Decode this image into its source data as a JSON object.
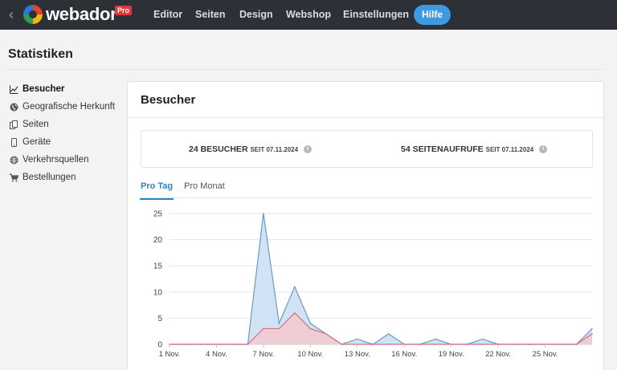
{
  "topbar": {
    "brand": "webador",
    "badge": "Pro",
    "nav": [
      "Editor",
      "Seiten",
      "Design",
      "Webshop",
      "Einstellungen"
    ],
    "help": "Hilfe"
  },
  "page": {
    "title": "Statistiken"
  },
  "sidebar": {
    "items": [
      {
        "label": "Besucher",
        "icon": "chart-line-icon",
        "active": true
      },
      {
        "label": "Geografische Herkunft",
        "icon": "globe-icon",
        "active": false
      },
      {
        "label": "Seiten",
        "icon": "pages-icon",
        "active": false
      },
      {
        "label": "Geräte",
        "icon": "mobile-icon",
        "active": false
      },
      {
        "label": "Verkehrsquellen",
        "icon": "globe-traffic-icon",
        "active": false
      },
      {
        "label": "Bestellungen",
        "icon": "cart-icon",
        "active": false
      }
    ]
  },
  "card": {
    "title": "Besucher",
    "stats": {
      "visitors_main": "24 BESUCHER",
      "visitors_since": "SEIT 07.11.2024",
      "pageviews_main": "54 SEITENAUFRUFE",
      "pageviews_since": "SEIT 07.11.2024"
    },
    "tabs": [
      {
        "label": "Pro Tag",
        "active": true
      },
      {
        "label": "Pro Monat",
        "active": false
      }
    ]
  },
  "colors": {
    "topbar": "#2d3036",
    "accent": "#3d9ae0",
    "visitors_fill": "#c9def2",
    "visitors_line": "#6b9ac4",
    "pageviews_fill": "#f6c9cf",
    "pageviews_line": "#d4707f"
  },
  "chart_data": {
    "type": "area",
    "x": [
      "1 Nov.",
      "2 Nov.",
      "3 Nov.",
      "4 Nov.",
      "5 Nov.",
      "6 Nov.",
      "7 Nov.",
      "8 Nov.",
      "9 Nov.",
      "10 Nov.",
      "11 Nov.",
      "12 Nov.",
      "13 Nov.",
      "14 Nov.",
      "15 Nov.",
      "16 Nov.",
      "17 Nov.",
      "18 Nov.",
      "19 Nov.",
      "20 Nov.",
      "21 Nov.",
      "22 Nov.",
      "23 Nov.",
      "24 Nov.",
      "25 Nov.",
      "26 Nov.",
      "27 Nov.",
      "28 Nov."
    ],
    "x_tick_labels": [
      "1 Nov.",
      "4 Nov.",
      "7 Nov.",
      "10 Nov.",
      "13 Nov.",
      "16 Nov.",
      "19 Nov.",
      "22 Nov.",
      "25 Nov."
    ],
    "y_ticks": [
      0,
      5,
      10,
      15,
      20,
      25
    ],
    "ylim": [
      0,
      25
    ],
    "grid": true,
    "series": [
      {
        "values": [
          0,
          0,
          0,
          0,
          0,
          0,
          25,
          4,
          11,
          4,
          2,
          0,
          1,
          0,
          2,
          0,
          0,
          1,
          0,
          0,
          1,
          0,
          0,
          0,
          0,
          0,
          0,
          3
        ]
      },
      {
        "values": [
          0,
          0,
          0,
          0,
          0,
          0,
          3,
          3,
          6,
          3,
          2,
          0,
          0,
          0,
          0,
          0,
          0,
          0,
          0,
          0,
          0,
          0,
          0,
          0,
          0,
          0,
          0,
          2
        ]
      }
    ]
  }
}
